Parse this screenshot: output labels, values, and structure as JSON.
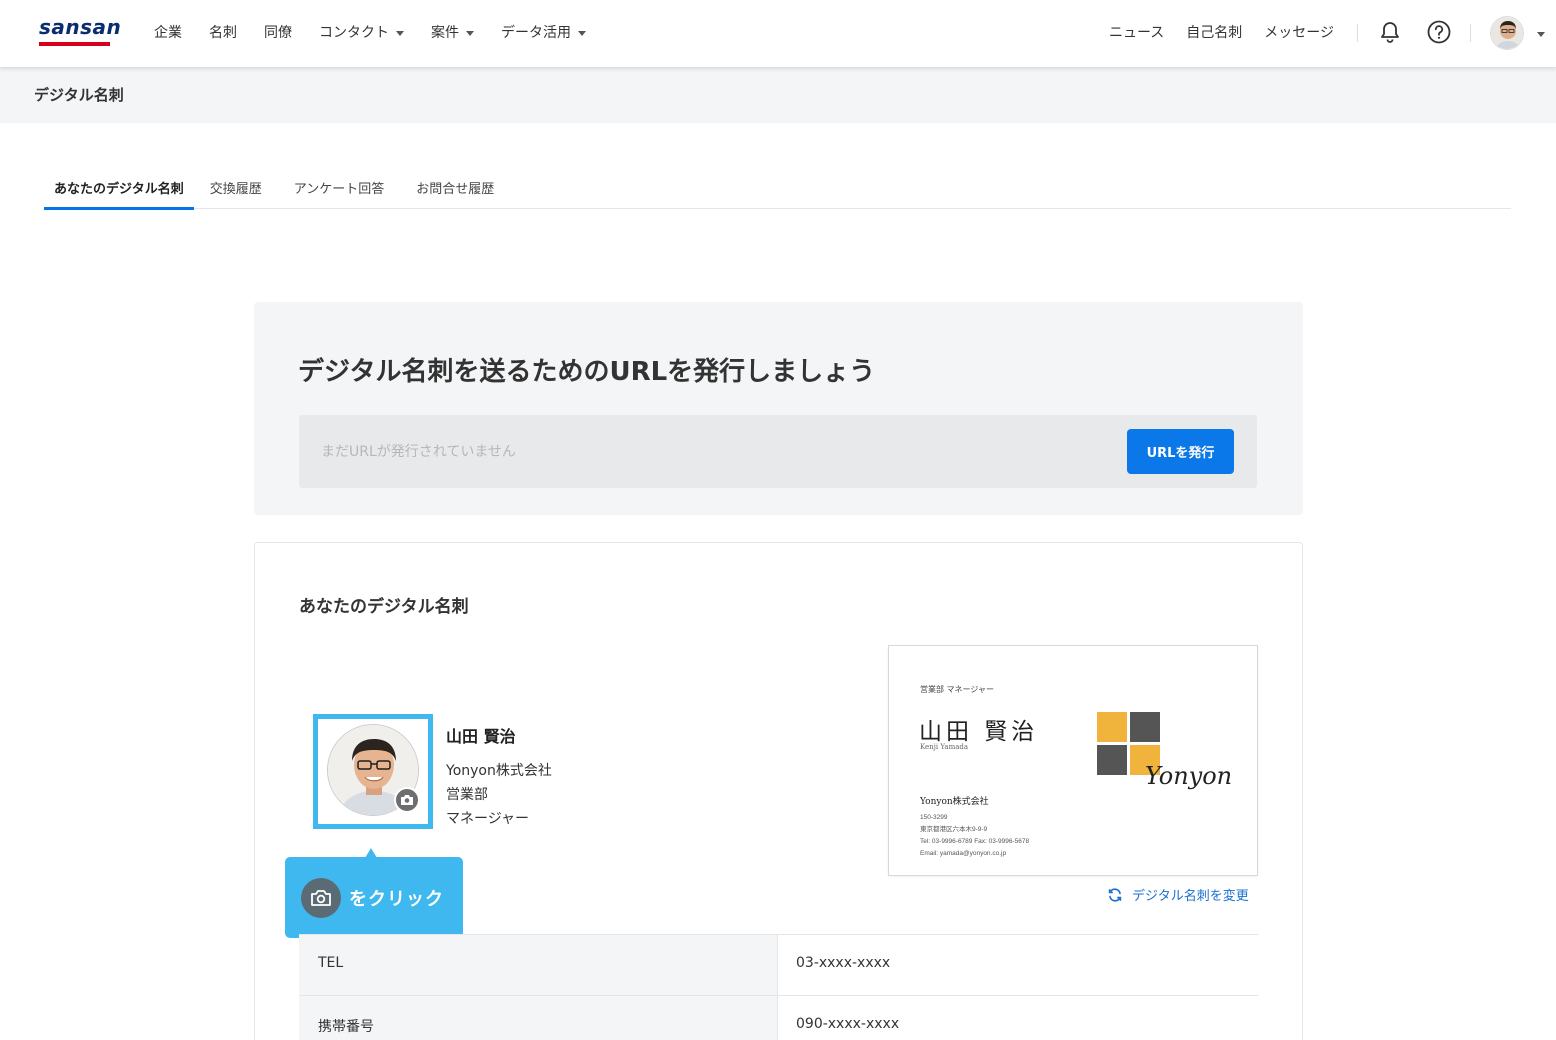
{
  "brand": {
    "logo_text": "sansan",
    "logo_color": "#0a2d6e",
    "logo_bar_color": "#d7001a"
  },
  "nav": {
    "left": [
      {
        "label": "企業",
        "dropdown": false
      },
      {
        "label": "名刺",
        "dropdown": false
      },
      {
        "label": "同僚",
        "dropdown": false
      },
      {
        "label": "コンタクト",
        "dropdown": true
      },
      {
        "label": "案件",
        "dropdown": true
      },
      {
        "label": "データ活用",
        "dropdown": true
      }
    ],
    "right": [
      {
        "label": "ニュース"
      },
      {
        "label": "自己名刺"
      },
      {
        "label": "メッセージ"
      }
    ],
    "icons": [
      "bell-icon",
      "help-icon",
      "avatar",
      "chevron-down-icon"
    ]
  },
  "page": {
    "title": "デジタル名刺"
  },
  "tabs": [
    {
      "label": "あなたのデジタル名刺",
      "active": true
    },
    {
      "label": "交換履歴",
      "active": false
    },
    {
      "label": "アンケート回答",
      "active": false
    },
    {
      "label": "お問合せ履歴",
      "active": false
    }
  ],
  "url_panel": {
    "title": "デジタル名刺を送るためのURLを発行しましょう",
    "placeholder": "まだURLが発行されていません",
    "button_label": "URLを発行"
  },
  "card_panel": {
    "title": "あなたのデジタル名刺",
    "person": {
      "name": "山田 賢治",
      "company": "Yonyon株式会社",
      "department": "営業部",
      "position": "マネージャー"
    },
    "tooltip_text": "をクリック",
    "business_card": {
      "role": "営業部 マネージャー",
      "name": "山田 賢治",
      "roman_name": "Kenji Yamada",
      "company": "Yonyon株式会社",
      "postal": "150-3299",
      "address": "東京都港区六本木9-9-9",
      "tel_fax": "Tel: 03-9996-6789   Fax: 03-9996-5678",
      "email": "Email: yamada@yonyon.co.jp",
      "logo_text": "Yonyon"
    },
    "change_link": "デジタル名刺を変更",
    "info_rows": [
      {
        "label": "TEL",
        "value": "03-xxxx-xxxx"
      },
      {
        "label": "携帯番号",
        "value": "090-xxxx-xxxx"
      }
    ]
  },
  "colors": {
    "accent": "#0a78e8",
    "tooltip": "#3fb8ef",
    "link": "#1a6fd1",
    "tab_indicator": "#0076e8"
  }
}
